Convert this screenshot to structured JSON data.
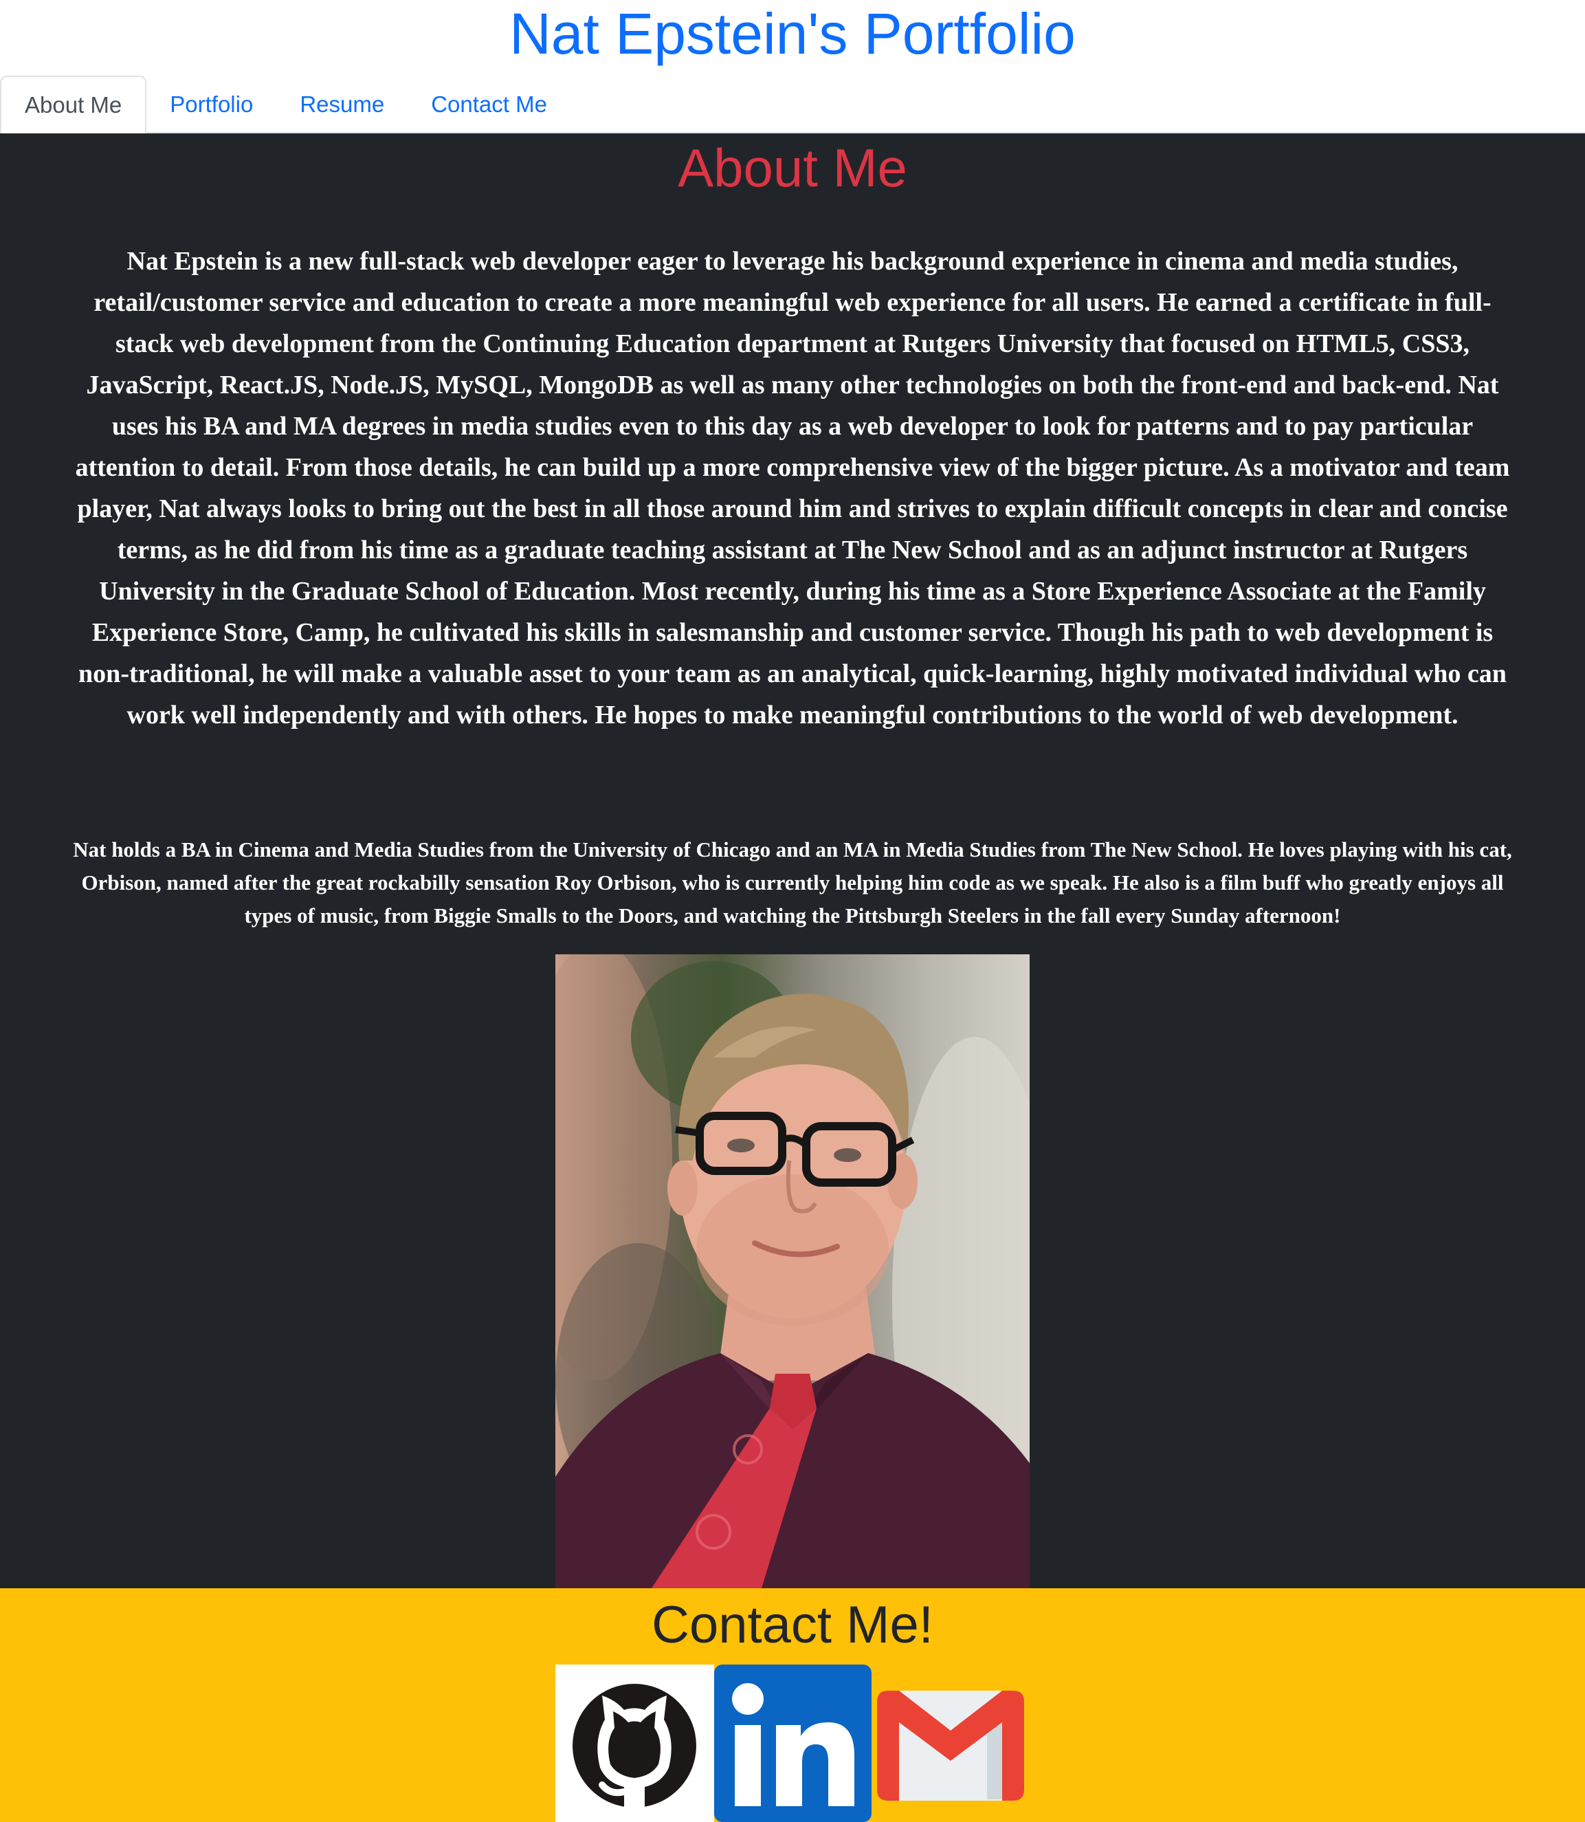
{
  "header": {
    "title": "Nat Epstein's Portfolio",
    "tabs": [
      {
        "label": "About Me",
        "active": true
      },
      {
        "label": "Portfolio",
        "active": false
      },
      {
        "label": "Resume",
        "active": false
      },
      {
        "label": "Contact Me",
        "active": false
      }
    ]
  },
  "about": {
    "heading": "About Me",
    "bio": "Nat Epstein is a new full-stack web developer eager to leverage his background experience in cinema and media studies, retail/customer service and education to create a more meaningful web experience for all users. He earned a certificate in full-stack web development from the Continuing Education department at Rutgers University that focused on HTML5, CSS3, JavaScript, React.JS, Node.JS, MySQL, MongoDB as well as many other technologies on both the front-end and back-end. Nat uses his BA and MA degrees in media studies even to this day as a web developer to look for patterns and to pay particular attention to detail. From those details, he can build up a more comprehensive view of the bigger picture. As a motivator and team player, Nat always looks to bring out the best in all those around him and strives to explain difficult concepts in clear and concise terms, as he did from his time as a graduate teaching assistant at The New School and as an adjunct instructor at Rutgers University in the Graduate School of Education. Most recently, during his time as a Store Experience Associate at the Family Experience Store, Camp, he cultivated his skills in salesmanship and customer service. Though his path to web development is non-traditional, he will make a valuable asset to your team as an analytical, quick-learning, highly motivated individual who can work well independently and with others. He hopes to make meaningful contributions to the world of web development.",
    "personal": "Nat holds a BA in Cinema and Media Studies from the University of Chicago and an MA in Media Studies from The New School. He loves playing with his cat, Orbison, named after the great rockabilly sensation Roy Orbison, who is currently helping him code as we speak. He also is a film buff who greatly enjoys all types of music, from Biggie Smalls to the Doors, and watching the Pittsburgh Steelers in the fall every Sunday afternoon!"
  },
  "contact": {
    "heading": "Contact Me!",
    "links": [
      {
        "icon": "github-icon"
      },
      {
        "icon": "linkedin-icon",
        "text": "in"
      },
      {
        "icon": "gmail-icon"
      }
    ]
  },
  "colors": {
    "brand_blue": "#0d6efd",
    "about_background": "#212529",
    "about_heading": "#dc3545",
    "contact_background": "#ffc107",
    "linkedin_blue": "#0a66c2",
    "gmail_red": "#ea4335"
  }
}
